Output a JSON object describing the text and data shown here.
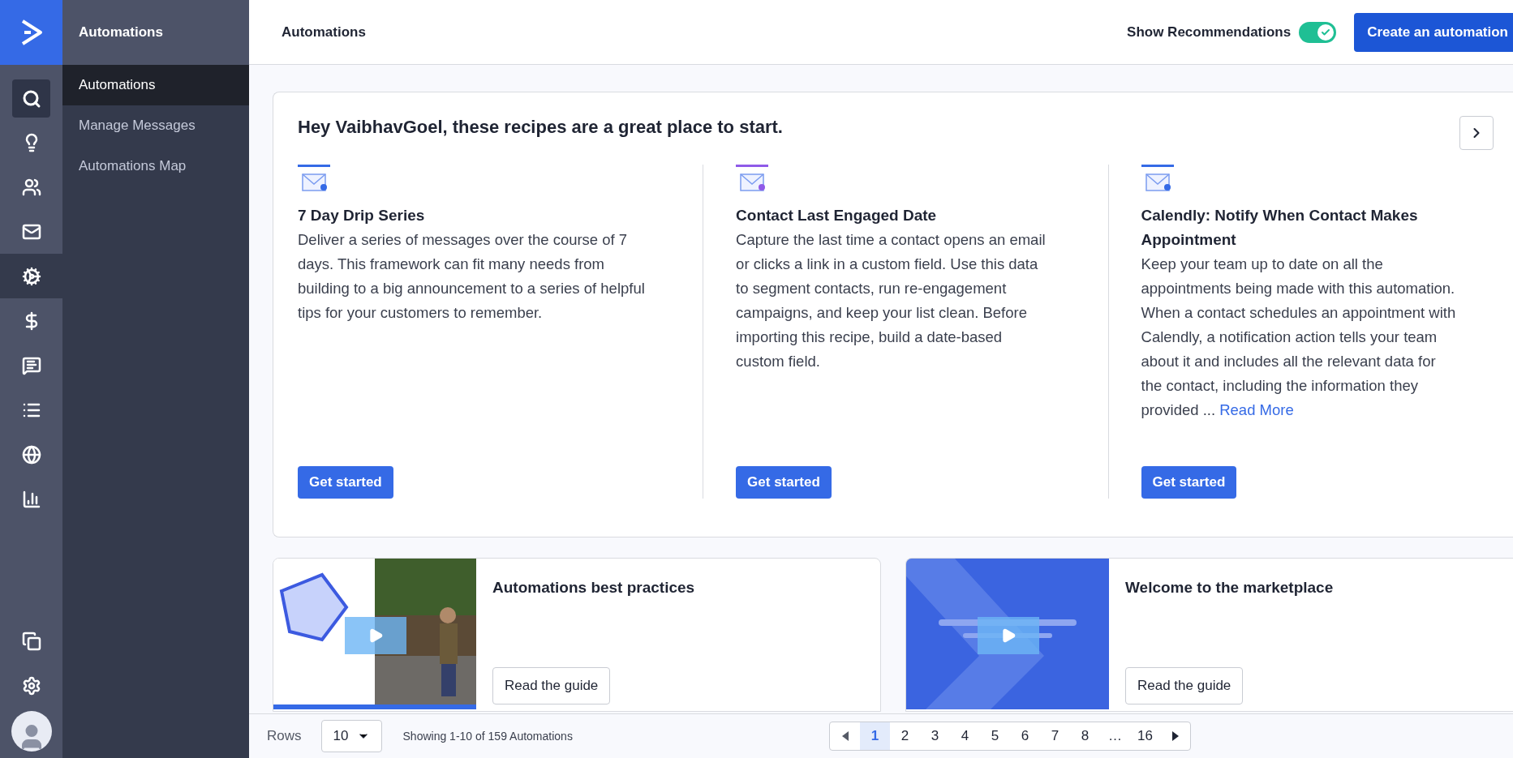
{
  "rail": [
    {
      "selected": false
    },
    {
      "selected": false
    },
    {
      "selected": false
    },
    {
      "selected": true
    },
    {
      "selected": false
    },
    {
      "selected": false
    },
    {
      "selected": false
    },
    {
      "selected": false
    },
    {
      "selected": false
    }
  ],
  "sidebar": {
    "title": "Automations",
    "items": [
      {
        "label": "Automations",
        "selected": true
      },
      {
        "label": "Manage Messages",
        "selected": false
      },
      {
        "label": "Automations Map",
        "selected": false
      }
    ]
  },
  "header": {
    "title": "Automations",
    "toggle_label": "Show Recommendations",
    "toggle_on": true,
    "create_button": "Create an automation"
  },
  "recipes": {
    "heading": "Hey VaibhavGoel, these recipes are a great place to start.",
    "cards": [
      {
        "title": "7 Day Drip Series",
        "description": "Deliver a series of messages over the course of 7 days. This framework can fit many needs from building to a big announcement to a series of helpful tips for your customers to remember.",
        "button": "Get started",
        "color": "#356ae6"
      },
      {
        "title": "Contact Last Engaged Date",
        "description": "Capture the last time a contact opens an email or clicks a link in a custom field. Use this data to segment contacts, run re-engagement campaigns, and keep your list clean. Before importing this recipe, build a date-based custom field.",
        "button": "Get started",
        "color": "#8f5ae8"
      },
      {
        "title": "Calendly: Notify When Contact Makes Appointment",
        "description": "Keep your team up to date on all the appointments being made with this automation. When a contact schedules an appointment with Calendly, a notification action tells your team about it and includes all the relevant data for the contact, including the information they provided ...",
        "read_more": "Read More",
        "button": "Get started",
        "color": "#356ae6"
      }
    ]
  },
  "guides": [
    {
      "title": "Automations best practices",
      "button": "Read the guide",
      "kind": "talk"
    },
    {
      "title": "Welcome to the marketplace",
      "button": "Read the guide",
      "kind": "brand"
    }
  ],
  "footer": {
    "rows_label": "Rows",
    "rows_value": "10",
    "showing": "Showing 1-10 of 159 Automations",
    "pages": [
      {
        "label": "1",
        "selected": true
      },
      {
        "label": "2",
        "selected": false
      },
      {
        "label": "3",
        "selected": false
      },
      {
        "label": "4",
        "selected": false
      },
      {
        "label": "5",
        "selected": false
      },
      {
        "label": "6",
        "selected": false
      },
      {
        "label": "7",
        "selected": false
      },
      {
        "label": "8",
        "selected": false
      },
      {
        "label": "…",
        "selected": false
      },
      {
        "label": "16",
        "selected": false
      }
    ]
  }
}
